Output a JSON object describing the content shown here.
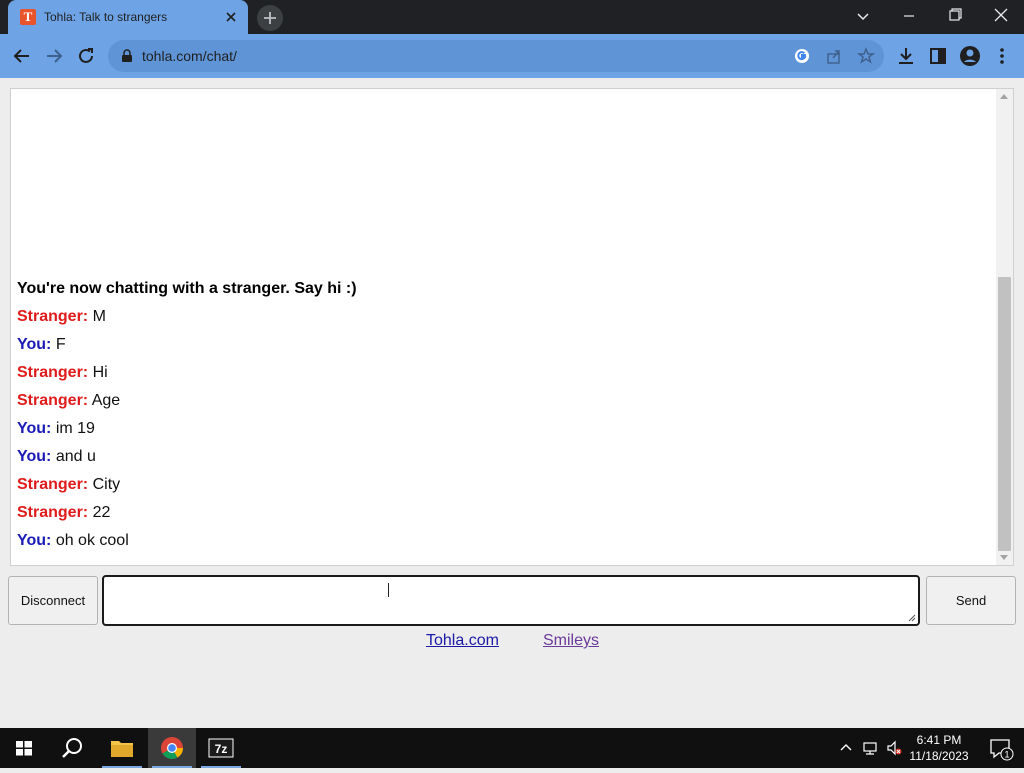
{
  "browser": {
    "tab_title": "Tohla: Talk to strangers",
    "favicon_letter": "T",
    "url": "tohla.com/chat/"
  },
  "chat": {
    "status": "You're now chatting with a stranger. Say hi :)",
    "messages": [
      {
        "who": "Stranger:",
        "text": "M",
        "role": "stranger"
      },
      {
        "who": "You:",
        "text": "F",
        "role": "you"
      },
      {
        "who": "Stranger:",
        "text": "Hi",
        "role": "stranger"
      },
      {
        "who": "Stranger:",
        "text": "Age",
        "role": "stranger"
      },
      {
        "who": "You:",
        "text": "im 19",
        "role": "you"
      },
      {
        "who": "You:",
        "text": "and u",
        "role": "you"
      },
      {
        "who": "Stranger:",
        "text": "City",
        "role": "stranger"
      },
      {
        "who": "Stranger:",
        "text": "22",
        "role": "stranger"
      },
      {
        "who": "You:",
        "text": "oh ok cool",
        "role": "you"
      }
    ]
  },
  "controls": {
    "disconnect_label": "Disconnect",
    "send_label": "Send",
    "input_value": ""
  },
  "links": {
    "home": "Tohla.com",
    "smileys": "Smileys"
  },
  "taskbar": {
    "time": "6:41 PM",
    "date": "11/18/2023",
    "notification_count": "1",
    "apps": [
      "start-icon",
      "search-icon",
      "file-explorer-icon",
      "chrome-icon",
      "7zip-icon"
    ]
  },
  "colors": {
    "stranger": "#e01b1b",
    "you": "#1a1ab8",
    "chrome_accent": "#6ea4e6"
  }
}
